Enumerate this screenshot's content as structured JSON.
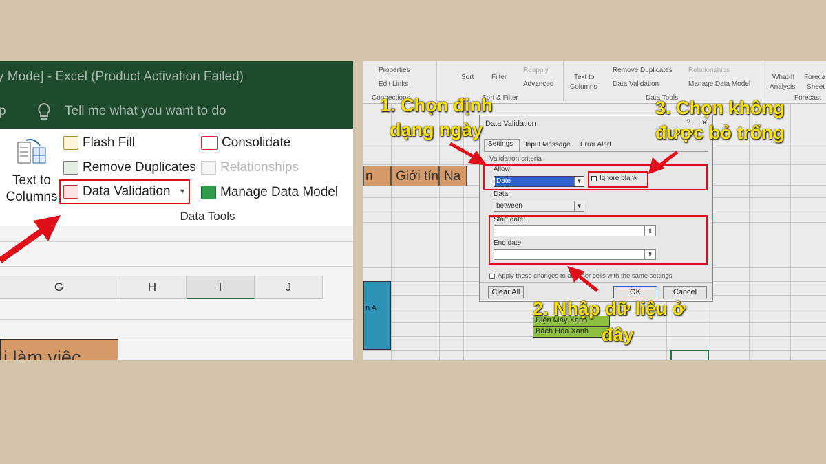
{
  "left": {
    "title": "y Mode]  -  Excel (Product Activation Failed)",
    "tell_me_p": "p",
    "tell_me": "Tell me what you want to do",
    "text_to_columns": [
      "Text to",
      "Columns"
    ],
    "flash_fill": "Flash Fill",
    "remove_duplicates": "Remove Duplicates",
    "data_validation": "Data Validation",
    "consolidate": "Consolidate",
    "relationships": "Relationships",
    "manage_data_model": "Manage Data Model",
    "group_label": "Data Tools",
    "columns": [
      "G",
      "H",
      "I",
      "J"
    ],
    "cell_text": "i làm việc"
  },
  "right": {
    "ribbon": {
      "properties": "Properties",
      "edit_links": "Edit Links",
      "connections": "Connections",
      "sort": "Sort",
      "filter": "Filter",
      "reapply": "Reapply",
      "advanced": "Advanced",
      "sort_filter": "Sort & Filter",
      "text_to": "Text to",
      "columns": "Columns",
      "remove_duplicates": "Remove Duplicates",
      "data_validation": "Data Validation",
      "relationships": "Relationships",
      "manage_data_model": "Manage Data Model",
      "data_tools": "Data Tools",
      "what_if": "What-If",
      "analysis": "Analysis",
      "forecast_sheet": "Forecast",
      "sheet": "Sheet",
      "forecast": "Forecast"
    },
    "sheet": {
      "header_n": "n",
      "header_gioi_tinh": "Giới tính",
      "header_na": "Na",
      "cell_an_a": "n A",
      "cell_dien_may_xanh": "Điện Máy Xanh",
      "cell_bach_hoa_xanh": "Bách Hóa Xanh"
    },
    "dialog": {
      "title": "Data Validation",
      "help": "?",
      "close": "✕",
      "tabs": [
        "Settings",
        "Input Message",
        "Error Alert"
      ],
      "criteria": "Validation criteria",
      "allow_label": "Allow:",
      "allow_value": "Date",
      "ignore_blank": "Ignore blank",
      "data_label": "Data:",
      "data_value": "between",
      "start_date": "Start date:",
      "end_date": "End date:",
      "apply_text": "Apply these changes to all other cells with the same settings",
      "clear_all": "Clear All",
      "ok": "OK",
      "cancel": "Cancel"
    }
  },
  "annotations": {
    "step1_line1": "1. Chọn định",
    "step1_line2": "dạng ngày",
    "step2_line1": "2. Nhập dữ liệu ở",
    "step2_line2": "đây",
    "step3_line1": "3. Chọn không",
    "step3_line2": "được bỏ trống"
  },
  "colors": {
    "background": "#d2c4ab",
    "excel_green": "#1e4b2c",
    "highlight_red": "#e0101a",
    "annotation_yellow": "#f8e000",
    "orange_header": "#d59a68",
    "teal_cell": "#2f93b8",
    "green_cell": "#8fbf3f"
  }
}
